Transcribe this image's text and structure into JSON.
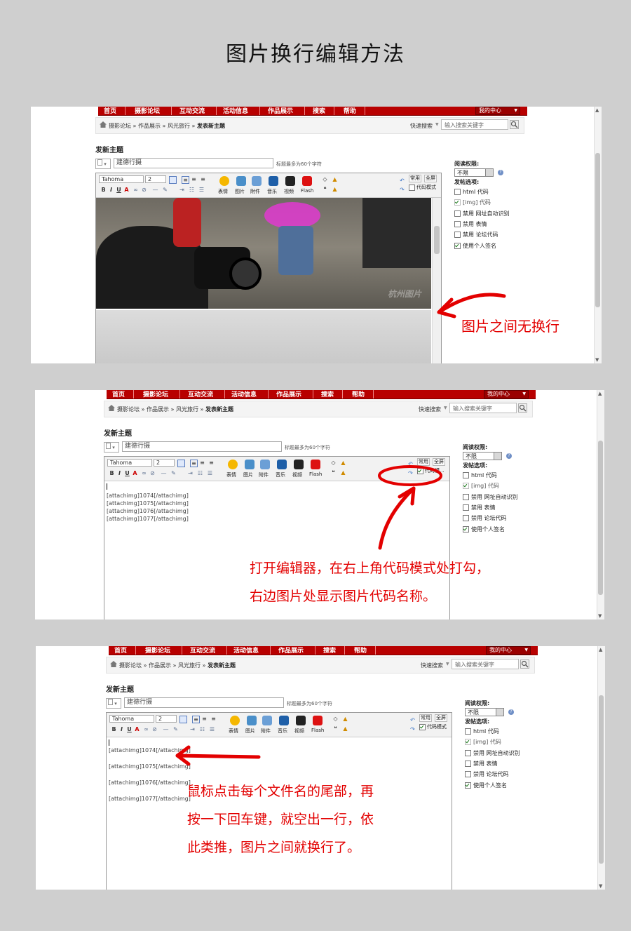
{
  "page_title": "图片换行编辑方法",
  "forum": {
    "nav": [
      "首页",
      "摄影论坛",
      "互动交流",
      "活动信息",
      "作品展示",
      "搜索",
      "帮助"
    ],
    "my_center": "我的中心",
    "breadcrumb": {
      "root": "摄影论坛",
      "sep": " » ",
      "items": [
        "作品展示",
        "风光旅行"
      ],
      "current": "发表新主题"
    },
    "quick_search_label": "快速搜索",
    "search_placeholder": "输入搜索关键字",
    "new_topic_heading": "发新主题",
    "title_value": "建德行摄",
    "title_hint": "标题最多为60个字符"
  },
  "editor": {
    "font_name": "Tahoma",
    "font_size": "2",
    "format_buttons": [
      "B",
      "I",
      "U",
      "A"
    ],
    "tool_labels": [
      "表情",
      "图片",
      "附件",
      "音乐",
      "视频",
      "Flash"
    ],
    "common_label": "常用",
    "fullscreen_label": "全屏",
    "code_mode_label": "代码模式",
    "code_mode_label_short": "代码模..."
  },
  "sidebar": {
    "read_perm_label": "阅读权限:",
    "read_perm_value": "不限",
    "post_options_label": "发帖选项:",
    "options": [
      {
        "label": "html 代码",
        "checked": false,
        "disabled": false
      },
      {
        "label": "[img] 代码",
        "checked": true,
        "disabled": true
      },
      {
        "label": "禁用 网址自动识别",
        "checked": false,
        "disabled": false
      },
      {
        "label": "禁用 表情",
        "checked": false,
        "disabled": false
      },
      {
        "label": "禁用 论坛代码",
        "checked": false,
        "disabled": false
      },
      {
        "label": "使用个人签名",
        "checked": true,
        "disabled": false
      }
    ]
  },
  "attachments": [
    "[attachimg]1074[/attachimg]",
    "[attachimg]1075[/attachimg]",
    "[attachimg]1076[/attachimg]",
    "[attachimg]1077[/attachimg]"
  ],
  "notes": {
    "note1": "图片之间无换行",
    "note2_line1": "打开编辑器，在右上角代码模式处打勾，",
    "note2_line2": "右边图片处显示图片代码名称。",
    "note3_line1": "鼠标点击每个文件名的尾部，再",
    "note3_line2": "按一下回车键，就空出一行，依",
    "note3_line3": "此类推，图片之间就换行了。"
  },
  "photo_watermark": "杭州图片",
  "colors": {
    "nav": "#b80000",
    "annotation": "#e30000",
    "background": "#cfcfcf"
  }
}
